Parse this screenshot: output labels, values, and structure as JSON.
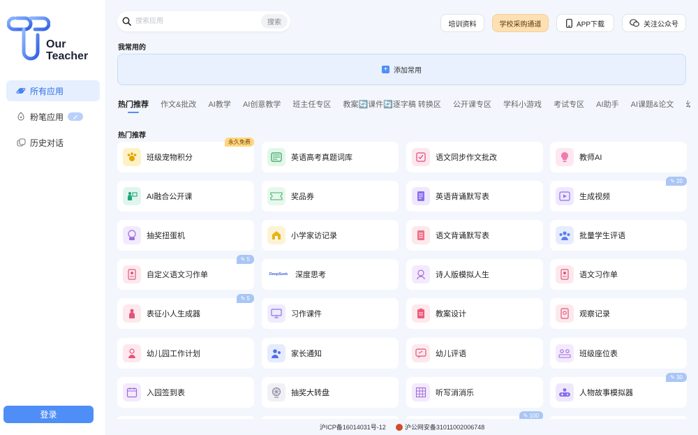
{
  "brand": {
    "line1": "Our",
    "line2": "Teacher"
  },
  "sidebar": {
    "items": [
      {
        "label": "所有应用",
        "icon": "planet-icon",
        "active": true
      },
      {
        "label": "粉笔应用",
        "icon": "pen-nib-icon",
        "badge": "pencil-icon"
      },
      {
        "label": "历史对话",
        "icon": "chat-history-icon"
      }
    ],
    "login": "登录"
  },
  "search": {
    "placeholder": "搜索应用",
    "button": "搜索"
  },
  "topbar": {
    "training": "培训资料",
    "purchase": "学校采购通道",
    "app": "APP下载",
    "follow": "关注公众号"
  },
  "favorites": {
    "title": "我常用的",
    "add": "添加常用"
  },
  "tabs": [
    "热门推荐",
    "作文&批改",
    "AI教学",
    "AI创意教学",
    "班主任专区",
    "教案🔄课件🔄逐字稿 转换区",
    "公开课专区",
    "学科小游戏",
    "考试专区",
    "AI助手",
    "AI课题&论文",
    "幼"
  ],
  "section": {
    "title": "热门推荐"
  },
  "apps": [
    {
      "label": "班级宠物积分",
      "icon": "pet-paw-icon",
      "tag": "永久免费"
    },
    {
      "label": "英语高考真题词库",
      "icon": "book-icon"
    },
    {
      "label": "语文同步作文批改",
      "icon": "essay-check-icon"
    },
    {
      "label": "教师AI",
      "icon": "lightbulb-icon"
    },
    {
      "label": "AI融合公开课",
      "icon": "teacher-board-icon"
    },
    {
      "label": "奖品券",
      "icon": "ticket-icon"
    },
    {
      "label": "英语背诵默写表",
      "icon": "document-icon"
    },
    {
      "label": "生成视频",
      "icon": "video-icon",
      "count": "20"
    },
    {
      "label": "抽奖扭蛋机",
      "icon": "gacha-icon"
    },
    {
      "label": "小学家访记录",
      "icon": "home-visit-icon"
    },
    {
      "label": "语文背诵默写表",
      "icon": "notebook-icon"
    },
    {
      "label": "批量学生评语",
      "icon": "students-icon"
    },
    {
      "label": "自定义语文习作单",
      "icon": "worksheet-icon",
      "count": "5"
    },
    {
      "label": "深度思考",
      "icon": "deepseek-icon",
      "icon_text": "DeepSeek"
    },
    {
      "label": "诗人版模拟人生",
      "icon": "poet-icon"
    },
    {
      "label": "语文习作单",
      "icon": "worksheet-icon"
    },
    {
      "label": "表征小人生成器",
      "icon": "figure-icon",
      "count": "5"
    },
    {
      "label": "习作课件",
      "icon": "slides-icon"
    },
    {
      "label": "教案设计",
      "icon": "lesson-plan-icon"
    },
    {
      "label": "观察记录",
      "icon": "observation-icon"
    },
    {
      "label": "幼儿园工作计划",
      "icon": "kindergarten-icon"
    },
    {
      "label": "家长通知",
      "icon": "parents-icon"
    },
    {
      "label": "幼儿评语",
      "icon": "comment-icon"
    },
    {
      "label": "班级座位表",
      "icon": "seating-icon"
    },
    {
      "label": "入园签到表",
      "icon": "calendar-icon"
    },
    {
      "label": "抽奖大转盘",
      "icon": "wheel-icon"
    },
    {
      "label": "听写消消乐",
      "icon": "grid-game-icon"
    },
    {
      "label": "人物故事模拟器",
      "icon": "gamepad-icon",
      "count": "30"
    }
  ],
  "partial_row_count": "100",
  "footer": {
    "icp": "沪ICP备16014031号-12",
    "police": "沪公网安备31011002006748"
  },
  "colors": {
    "accent": "#4f8ef7",
    "gold": "#fde0b3",
    "tag": "#ffd680"
  }
}
